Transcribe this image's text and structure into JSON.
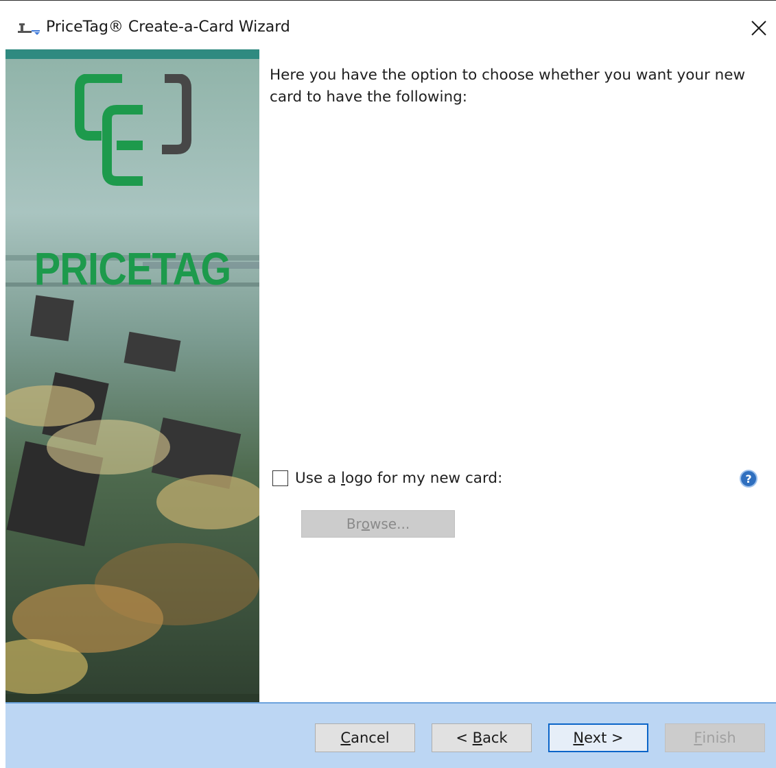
{
  "window": {
    "title": "PriceTag® Create-a-Card Wizard",
    "close_icon": "close-icon",
    "app_icon": "scale-icon"
  },
  "sidebar": {
    "brand": "PRICETAG",
    "logo_icon": "cc-logo-icon",
    "brand_colors": {
      "green": "#1d9a4c",
      "gray": "#474747"
    }
  },
  "content": {
    "intro": "Here you have the option to choose whether you want your new card to have the following:",
    "logo_option": {
      "label_before": "Use a ",
      "label_mnemonic": "l",
      "label_after": "ogo for my new card:",
      "checked": false
    },
    "help_icon": "help-icon",
    "browse": {
      "before": "Br",
      "mnemonic": "o",
      "after": "wse...",
      "enabled": false
    }
  },
  "footer": {
    "cancel": {
      "mnemonic": "C",
      "rest": "ancel"
    },
    "back": {
      "prefix": "< ",
      "mnemonic": "B",
      "rest": "ack"
    },
    "next": {
      "mnemonic": "N",
      "rest": "ext >"
    },
    "finish": {
      "mnemonic": "F",
      "rest": "inish",
      "enabled": false
    }
  },
  "colors": {
    "footer_bg": "#bcd6f3",
    "accent": "#0a64c8"
  }
}
